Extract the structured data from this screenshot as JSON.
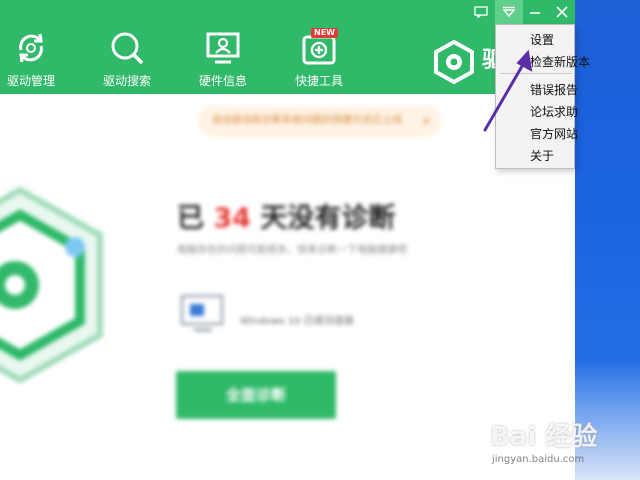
{
  "window_controls": {
    "feedback_icon": "chat-icon",
    "menu_icon": "dropdown-menu-icon",
    "minimize_icon": "minimize-icon",
    "close_icon": "close-icon"
  },
  "nav": {
    "items": [
      {
        "label": "驱动管理",
        "icon": "refresh-icon"
      },
      {
        "label": "驱动搜索",
        "icon": "search-icon"
      },
      {
        "label": "硬件信息",
        "icon": "monitor-user-icon"
      },
      {
        "label": "快捷工具",
        "icon": "toolbox-icon",
        "badge": "NEW"
      }
    ]
  },
  "brand": {
    "text": "驱"
  },
  "notice": {
    "text": "自动驱动和诊断系统问题的快捷方式已上线",
    "close": "×"
  },
  "main": {
    "headline_prefix": "已",
    "days": "34",
    "headline_suffix": "天没有诊断",
    "subline": "电脑存在的问题可能很多，快来诊断一下电脑健康吧",
    "system_text": "Windows 10 已成功连接",
    "scan_button": "全面诊断"
  },
  "menu": {
    "items": [
      {
        "label": "设置"
      },
      {
        "label": "检查新版本"
      },
      {
        "label": "错误报告"
      },
      {
        "label": "论坛求助"
      },
      {
        "label": "官方网站"
      },
      {
        "label": "关于"
      }
    ]
  },
  "watermark": {
    "main": "Bai 经验",
    "sub": "jingyan.baidu.com"
  },
  "colors": {
    "brand_green": "#2fb969",
    "annotation_purple": "#5b2ea8",
    "highlight_red": "#e53935"
  }
}
